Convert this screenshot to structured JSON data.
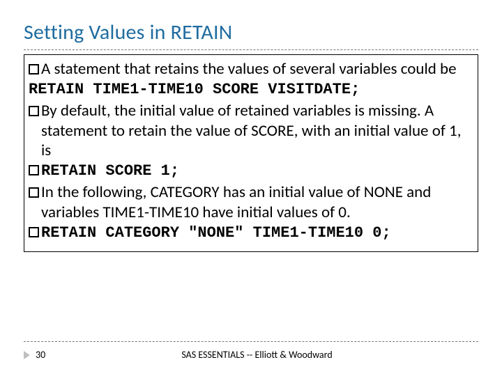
{
  "title": "Setting Values in RETAIN",
  "bullets": {
    "b1": "A statement that retains the values of several variables could be",
    "code1": "RETAIN TIME1-TIME10 SCORE VISITDATE;",
    "b2": "By default, the initial value of retained variables is missing. A statement to retain the value of SCORE, with an initial value of 1, is",
    "code2": "RETAIN SCORE 1;",
    "b3": "In the following, CATEGORY has an initial value of NONE and variables TIME1-TIME10 have initial values of 0.",
    "code3": "RETAIN CATEGORY \"NONE\" TIME1-TIME10 0;"
  },
  "footer": {
    "page": "30",
    "text": "SAS ESSENTIALS -- Elliott & Woodward"
  }
}
